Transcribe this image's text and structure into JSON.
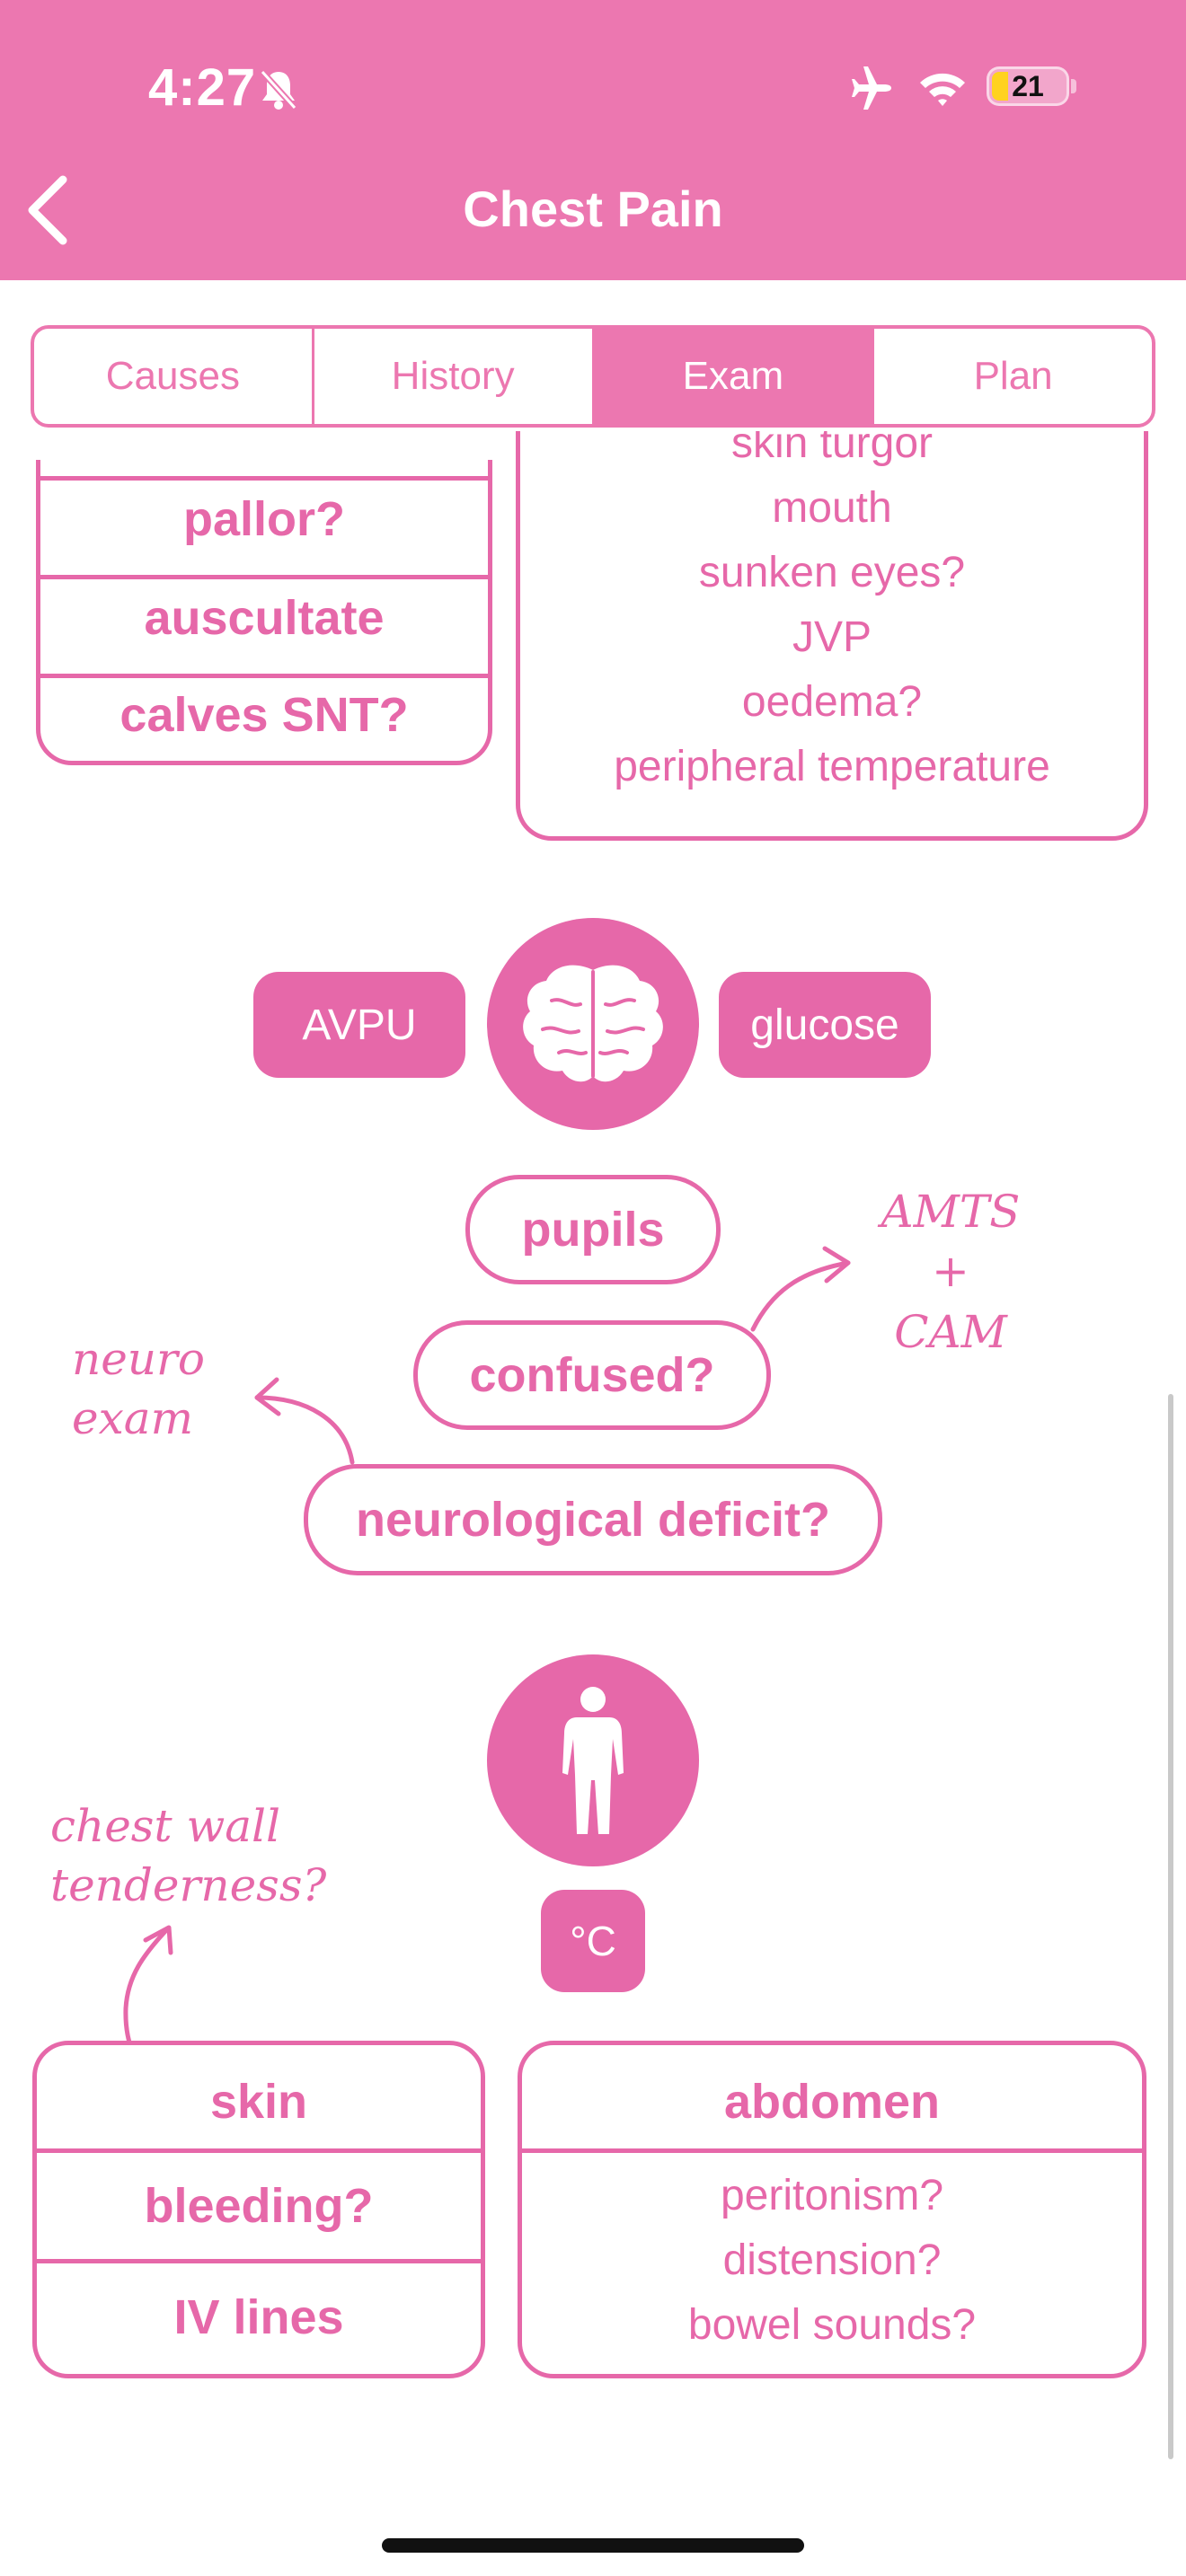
{
  "status_bar": {
    "time": "4:27",
    "battery": "21"
  },
  "nav": {
    "title": "Chest Pain"
  },
  "tabs": [
    {
      "label": "Causes"
    },
    {
      "label": "History"
    },
    {
      "label": "Exam"
    },
    {
      "label": "Plan"
    }
  ],
  "active_tab": "Exam",
  "left_box_top": {
    "items": [
      "pallor?",
      "auscultate",
      "calves SNT?"
    ]
  },
  "right_box_top": {
    "items": [
      "skin turgor",
      "mouth",
      "sunken eyes?",
      "JVP",
      "oedema?",
      "peripheral temperature"
    ]
  },
  "neuro": {
    "left_pill": "AVPU",
    "right_pill": "glucose",
    "pupils": "pupils",
    "confused": "confused?",
    "deficit": "neurological deficit?",
    "note_right_1": "AMTS",
    "note_right_2": "+",
    "note_right_3": "CAM",
    "note_left_1": "neuro",
    "note_left_2": "exam"
  },
  "body_section": {
    "temp": "°C",
    "note_1": "chest wall",
    "note_2": "tenderness?"
  },
  "left_box_bottom": {
    "items": [
      "skin",
      "bleeding?",
      "IV lines"
    ]
  },
  "right_box_bottom": {
    "heading": "abdomen",
    "items": [
      "peritonism?",
      "distension?",
      "bowel sounds?"
    ]
  },
  "colors": {
    "accent": "#e668a9",
    "header": "#ec77b0"
  }
}
